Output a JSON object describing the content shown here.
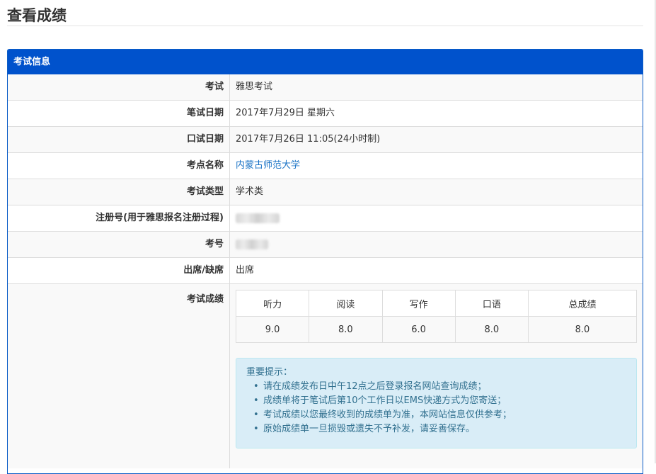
{
  "page": {
    "title": "查看成绩"
  },
  "panel": {
    "heading": "考试信息"
  },
  "rows": [
    {
      "label": "考试",
      "value": "雅思考试"
    },
    {
      "label": "笔试日期",
      "value": "2017年7月29日 星期六"
    },
    {
      "label": "口试日期",
      "value": "2017年7月26日 11:05(24小时制)"
    },
    {
      "label": "考点名称",
      "value": "内蒙古师范大学"
    },
    {
      "label": "考试类型",
      "value": "学术类"
    },
    {
      "label": "注册号(用于雅思报名注册过程)",
      "value": "1█████5"
    },
    {
      "label": "考号",
      "value": "0████4"
    },
    {
      "label": "出席/缺席",
      "value": "出席"
    }
  ],
  "scores": {
    "label": "考试成绩",
    "headers": [
      "听力",
      "阅读",
      "写作",
      "口语",
      "总成绩"
    ],
    "values": [
      "9.0",
      "8.0",
      "6.0",
      "8.0",
      "8.0"
    ]
  },
  "notice": {
    "title": "重要提示：",
    "items": [
      "请在成绩发布日中午12点之后登录报名网站查询成绩；",
      "成绩单将于笔试后第10个工作日以EMS快递方式为您寄送；",
      "考试成绩以您最终收到的成绩单为准，本网站信息仅供参考；",
      "原始成绩单一旦损毁或遗失不予补发，请妥善保存。"
    ]
  },
  "colors": {
    "panel_header": "#0052cc",
    "link": "#1a73c6",
    "notice_bg": "#d9edf7",
    "notice_text": "#31708f"
  }
}
